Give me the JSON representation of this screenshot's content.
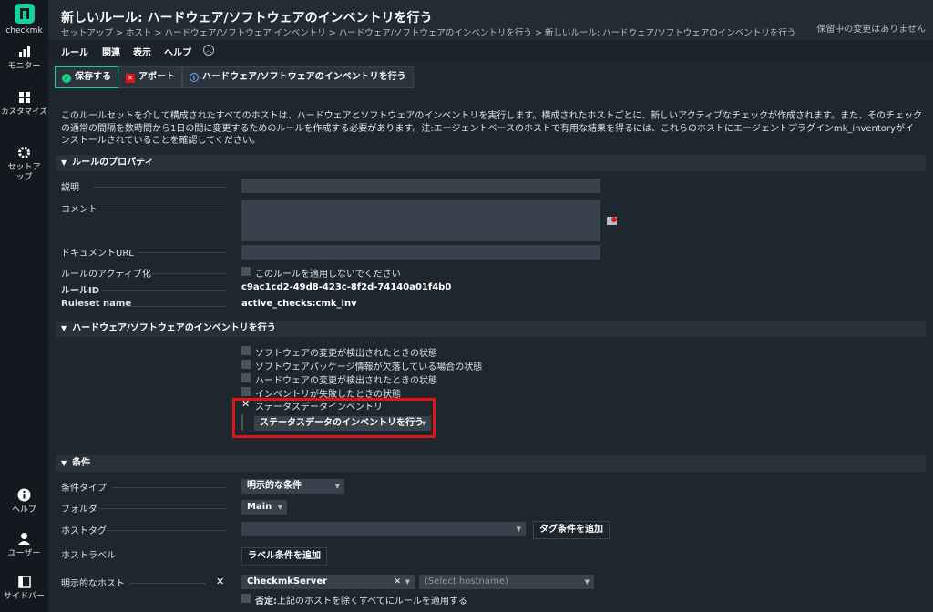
{
  "sidebar": {
    "logo": "checkmk",
    "items": [
      {
        "label": "モニター"
      },
      {
        "label": "カスタマイズ"
      },
      {
        "label": "セットアップ"
      },
      {
        "label": "ヘルプ"
      },
      {
        "label": "ユーザー"
      },
      {
        "label": "サイドバー"
      }
    ]
  },
  "header": {
    "title": "新しいルール: ハードウェア/ソフトウェアのインベントリを行う",
    "breadcrumb": "セットアップ > ホスト > ハードウェア/ソフトウェア インベントリ > ハードウェア/ソフトウェアのインベントリを行う > 新しいルール: ハードウェア/ソフトウェアのインベントリを行う",
    "pending": "保留中の変更はありません"
  },
  "menubar": {
    "items": [
      "ルール",
      "関連",
      "表示",
      "ヘルプ"
    ]
  },
  "toolbar": {
    "save": "保存する",
    "abort": "アボート",
    "inventory": "ハードウェア/ソフトウェアのインベントリを行う"
  },
  "help_text": "このルールセットを介して構成されたすべてのホストは、ハードウェアとソフトウェアのインベントリを実行します。構成されたホストごとに、新しいアクティブなチェックが作成されます。また、そのチェックの通常の間隔を数時間から1日の間に変更するためのルールを作成する必要があります。注:エージェントベースのホストで有用な結果を得るには、これらのホストにエージェントプラグインmk_inventoryがインストールされていることを確認してください。",
  "properties": {
    "title": "ルールのプロパティ",
    "description_label": "説明",
    "comment_label": "コメント",
    "docurl_label": "ドキュメントURL",
    "activation_label": "ルールのアクティブ化",
    "disable_label": "このルールを適用しないでください",
    "ruleid_label": "ルールID",
    "ruleid_value": "c9ac1cd2-49d8-423c-8f2d-74140a01f4b0",
    "ruleset_label": "Ruleset name",
    "ruleset_value": "active_checks:cmk_inv"
  },
  "inventory": {
    "title": "ハードウェア/ソフトウェアのインベントリを行う",
    "options": [
      "ソフトウェアの変更が検出されたときの状態",
      "ソフトウェアパッケージ情報が欠落している場合の状態",
      "ハードウェアの変更が検出されたときの状態",
      "インベントリが失敗したときの状態"
    ],
    "status_data_label": "ステータスデータインベントリ",
    "status_data_select": "ステータスデータのインベントリを行う"
  },
  "conditions": {
    "title": "条件",
    "type_label": "条件タイプ",
    "type_value": "明示的な条件",
    "folder_label": "フォルダ",
    "folder_value": "Main",
    "hosttag_label": "ホストタグ",
    "add_tag": "タグ条件を追加",
    "hostlabel_label": "ホストラベル",
    "add_label": "ラベル条件を追加",
    "explicit_label": "明示的なホスト",
    "host_value": "CheckmkServer",
    "host_placeholder": "(Select hostname)",
    "negate_bold": "否定:",
    "negate_text": "上記のホストを除くすべてにルールを適用する"
  },
  "colors": {
    "accent": "#13d389",
    "highlight": "#e0141b",
    "background": "#1e262e"
  }
}
